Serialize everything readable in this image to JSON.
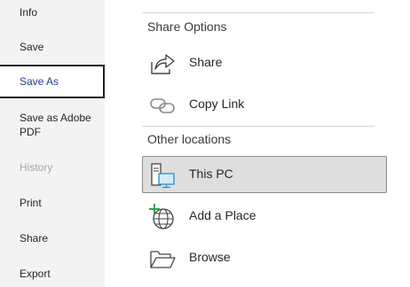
{
  "nav": {
    "items": [
      {
        "label": "Info",
        "state": "normal"
      },
      {
        "label": "Save",
        "state": "normal"
      },
      {
        "label": "Save As",
        "state": "selected"
      },
      {
        "label": "Save as Adobe PDF",
        "line1": "Save as Adobe",
        "line2": "PDF",
        "state": "normal"
      },
      {
        "label": "History",
        "state": "disabled"
      },
      {
        "label": "Print",
        "state": "normal"
      },
      {
        "label": "Share",
        "state": "normal"
      },
      {
        "label": "Export",
        "state": "normal"
      }
    ]
  },
  "main": {
    "sections": [
      {
        "header": "Share Options",
        "options": [
          {
            "label": "Share",
            "icon": "share-arrow-icon"
          },
          {
            "label": "Copy Link",
            "icon": "link-icon"
          }
        ]
      },
      {
        "header": "Other locations",
        "options": [
          {
            "label": "This PC",
            "icon": "computer-icon",
            "selected": true
          },
          {
            "label": "Add a Place",
            "icon": "globe-add-icon"
          },
          {
            "label": "Browse",
            "icon": "folder-open-icon"
          }
        ]
      }
    ]
  },
  "colors": {
    "nav_background": "#f3f3f3",
    "selected_option_background": "#dedede",
    "selected_nav_text": "#1f3d8f",
    "disabled_text": "#a6a6a6",
    "accent_green": "#1a9e3a",
    "accent_blue": "#2a8ad4"
  }
}
